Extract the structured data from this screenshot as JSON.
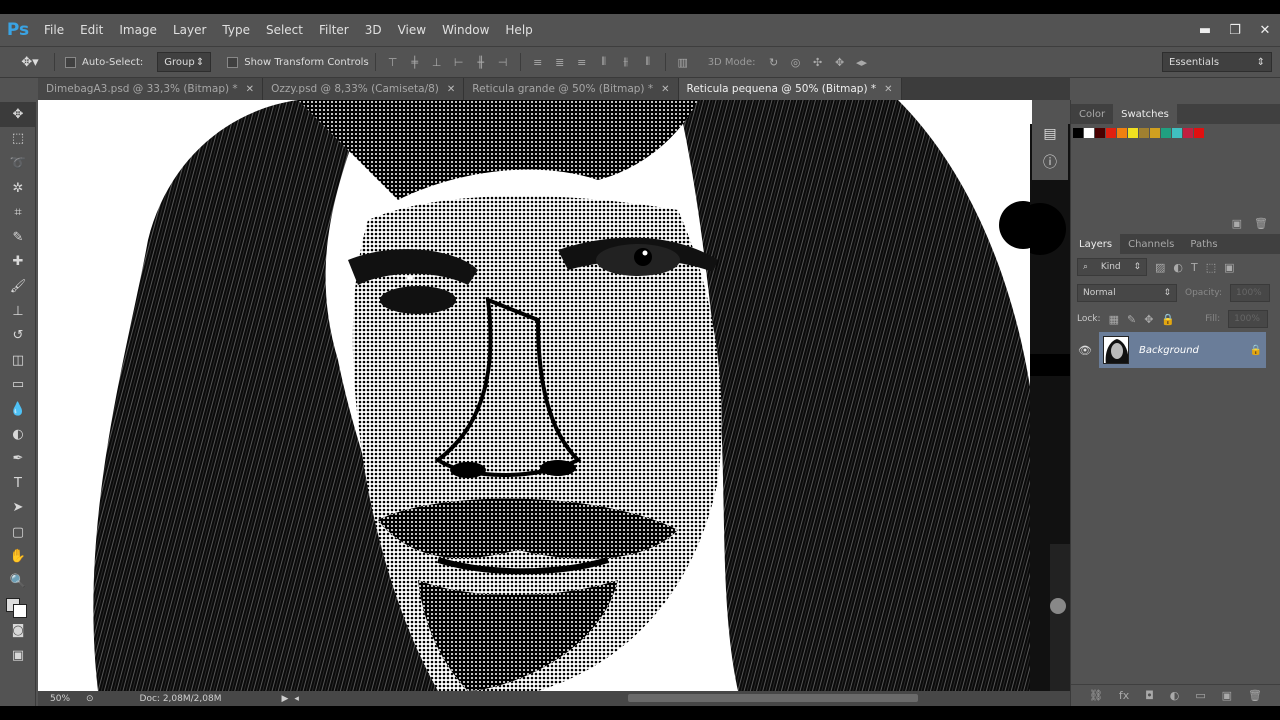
{
  "menubar": {
    "logo": "Ps",
    "items": [
      "File",
      "Edit",
      "Image",
      "Layer",
      "Type",
      "Select",
      "Filter",
      "3D",
      "View",
      "Window",
      "Help"
    ],
    "minimize": "▬",
    "restore": "❐",
    "close": "✕"
  },
  "options": {
    "auto_select_label": "Auto-Select:",
    "auto_select_value": "Group",
    "show_transform_label": "Show Transform Controls",
    "mode_3d_label": "3D Mode:",
    "workspace": "Essentials"
  },
  "tabs": [
    {
      "label": "DimebagA3.psd @ 33,3% (Bitmap) *",
      "active": false
    },
    {
      "label": "Ozzy.psd @ 8,33% (Camiseta/8)",
      "active": false
    },
    {
      "label": "Reticula grande @ 50% (Bitmap) *",
      "active": false
    },
    {
      "label": "Reticula pequena @ 50% (Bitmap) *",
      "active": true
    }
  ],
  "status": {
    "zoom": "50%",
    "doc": "Doc: 2,08M/2,08M"
  },
  "color_panel": {
    "tabs": [
      "Color",
      "Swatches"
    ],
    "active_tab": "Swatches",
    "swatches": [
      "#000000",
      "#ffffff",
      "#4a0000",
      "#e02010",
      "#f08010",
      "#f0e020",
      "#a08030",
      "#d0a020",
      "#20a080",
      "#40c0c0",
      "#c02040",
      "#e01010"
    ]
  },
  "layers_panel": {
    "tabs": [
      "Layers",
      "Channels",
      "Paths"
    ],
    "active_tab": "Layers",
    "kind_label": "Kind",
    "blend_mode": "Normal",
    "opacity_label": "Opacity:",
    "opacity_value": "100%",
    "lock_label": "Lock:",
    "fill_label": "Fill:",
    "fill_value": "100%",
    "layers": [
      {
        "name": "Background",
        "visible": true,
        "locked": true
      }
    ]
  }
}
